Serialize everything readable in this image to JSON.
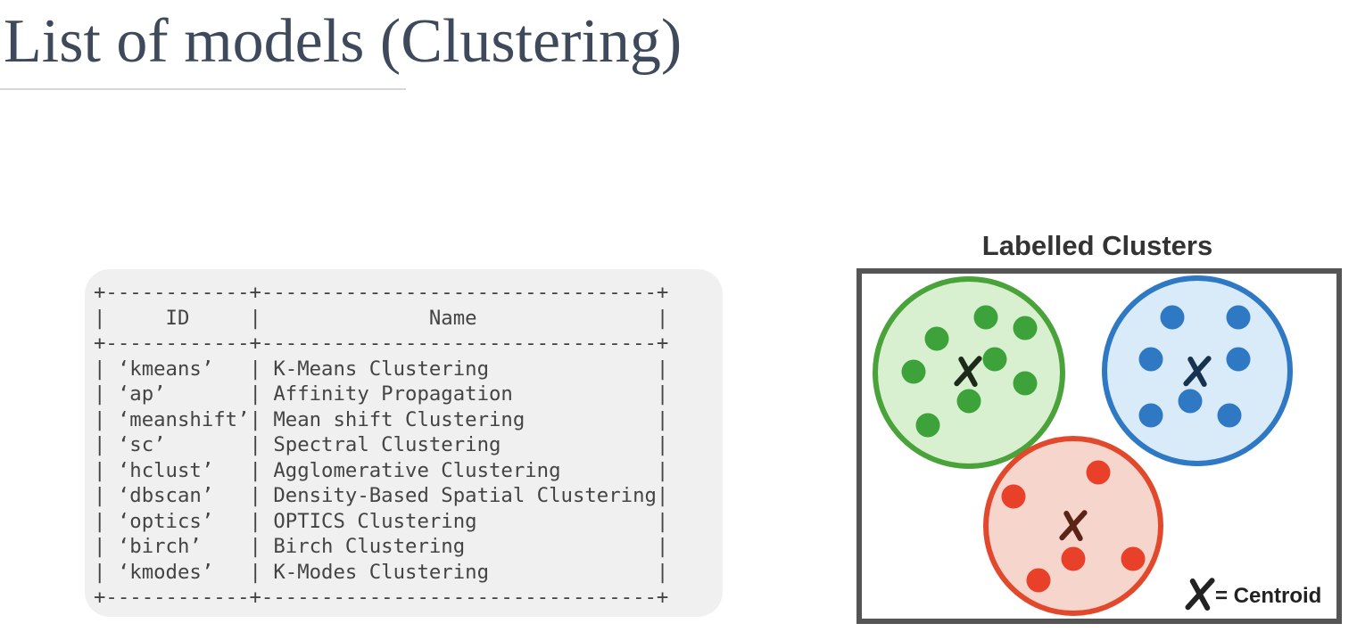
{
  "slide": {
    "title": "List of models (Clustering)"
  },
  "model_table": {
    "columns": [
      "ID",
      "Name"
    ],
    "rows": [
      {
        "id": "‘kmeans’",
        "name": "K-Means Clustering"
      },
      {
        "id": "‘ap’",
        "name": "Affinity Propagation"
      },
      {
        "id": "‘meanshift’",
        "name": "Mean shift Clustering"
      },
      {
        "id": "‘sc’",
        "name": "Spectral Clustering"
      },
      {
        "id": "‘hclust’",
        "name": "Agglomerative Clustering"
      },
      {
        "id": "‘dbscan’",
        "name": "Density-Based Spatial Clustering"
      },
      {
        "id": "‘optics’",
        "name": "OPTICS Clustering"
      },
      {
        "id": "‘birch’",
        "name": "Birch Clustering"
      },
      {
        "id": "‘kmodes’",
        "name": "K-Modes Clustering"
      }
    ]
  },
  "figure": {
    "title": "Labelled Clusters",
    "legend": {
      "marker": "X",
      "text": "= Centroid"
    },
    "clusters": [
      {
        "color": "green",
        "stroke": "#4aa33a",
        "fill": "#d8f0cf",
        "point": "#3ea23a",
        "centroid": "#1d2a1a"
      },
      {
        "color": "blue",
        "stroke": "#2f78c4",
        "fill": "#d9ebf8",
        "point": "#2f78c4",
        "centroid": "#16334f"
      },
      {
        "color": "red",
        "stroke": "#e2492c",
        "fill": "#f6d5cd",
        "point": "#e9402a",
        "centroid": "#5a2416"
      }
    ]
  }
}
